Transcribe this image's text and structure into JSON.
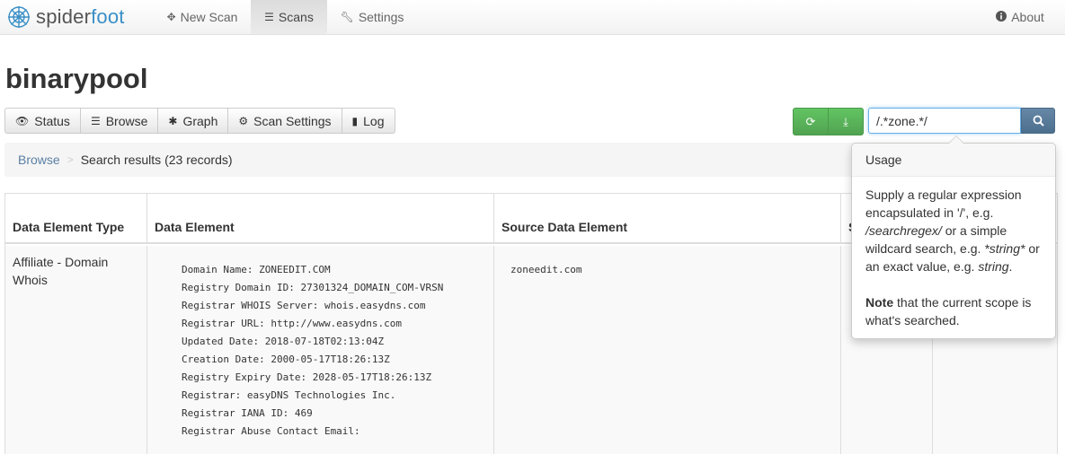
{
  "brand": {
    "name_part1": "spider",
    "name_part2": "foot",
    "logo_icon": "spider-web-logo"
  },
  "nav": {
    "new_scan": "New Scan",
    "scans": "Scans",
    "settings": "Settings",
    "about": "About"
  },
  "page_title": "binarypool",
  "tabs": {
    "status": "Status",
    "browse": "Browse",
    "graph": "Graph",
    "scan_settings": "Scan Settings",
    "log": "Log"
  },
  "search": {
    "value": "/.*zone.*/"
  },
  "breadcrumb": {
    "link": "Browse",
    "current": "Search results (23 records)"
  },
  "table": {
    "headers": {
      "type": "Data Element Type",
      "element": "Data Element",
      "source": "Source Data Element",
      "col4": "S M"
    },
    "row": {
      "type": "Affiliate - Domain Whois",
      "source": "zoneedit.com",
      "element_lines": [
        "Domain Name: ZONEEDIT.COM",
        "Registry Domain ID: 27301324_DOMAIN_COM-VRSN",
        "Registrar WHOIS Server: whois.easydns.com",
        "Registrar URL: http://www.easydns.com",
        "Updated Date: 2018-07-18T02:13:04Z",
        "Creation Date: 2000-05-17T18:26:13Z",
        "Registry Expiry Date: 2028-05-17T18:26:13Z",
        "Registrar: easyDNS Technologies Inc.",
        "Registrar IANA ID: 469",
        "Registrar Abuse Contact Email:"
      ]
    }
  },
  "popover": {
    "title": "Usage",
    "p1_a": "Supply a regular expression encapsulated in '/', e.g. ",
    "p1_b": "/searchregex/",
    "p1_c": " or a simple wildcard search, e.g. ",
    "p1_d": "*string*",
    "p1_e": " or an exact value, e.g. ",
    "p1_f": "string",
    "p1_g": ".",
    "p2_bold": "Note",
    "p2_rest": " that the current scope is what's searched."
  },
  "colors": {
    "accent": "#3a8fc7",
    "green": "#5cb85c",
    "link": "#5a7fa3"
  }
}
